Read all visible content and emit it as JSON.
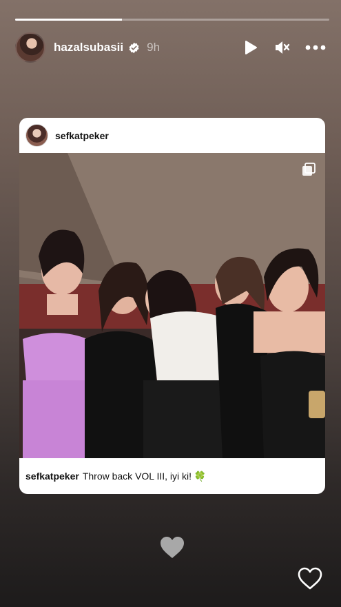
{
  "story": {
    "progress": 0.34,
    "username": "hazalsubasii",
    "verified": true,
    "time_ago": "9h"
  },
  "icons": {
    "play": "play-icon",
    "mute": "mute-icon",
    "more": "more-icon",
    "verified": "verified-badge-icon",
    "multiple_photos": "multiple-photos-icon",
    "heart_emoji": "grey-heart-icon",
    "like": "heart-outline-icon"
  },
  "post": {
    "username": "sefkatpeker",
    "caption_user": "sefkatpeker",
    "caption_text": "Throw back VOL III, iyi ki! 🍀"
  },
  "colors": {
    "background_top": "#837168",
    "background_bottom": "#1d1b1b",
    "verified_blue": "#ffffff",
    "card_bg": "#ffffff"
  }
}
